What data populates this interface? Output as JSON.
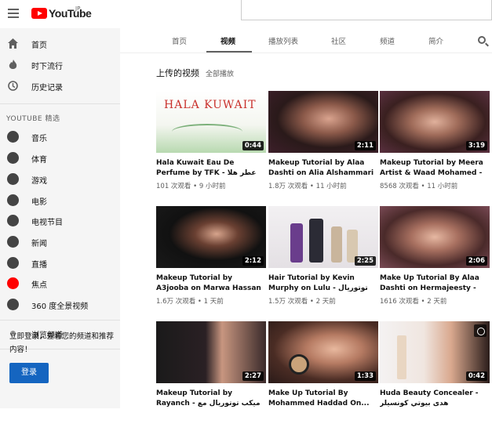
{
  "brand": {
    "logo_text": "YouTube",
    "region": "JP",
    "accent": "#ff0000"
  },
  "sidebar": {
    "main": [
      {
        "label": "首页",
        "icon": "home-icon"
      },
      {
        "label": "时下流行",
        "icon": "flame-icon"
      },
      {
        "label": "历史记录",
        "icon": "history-icon"
      }
    ],
    "section_header": "YOUTUBE 精选",
    "featured": [
      {
        "label": "音乐",
        "icon": "music-icon"
      },
      {
        "label": "体育",
        "icon": "sports-icon"
      },
      {
        "label": "游戏",
        "icon": "gaming-icon"
      },
      {
        "label": "电影",
        "icon": "movies-icon"
      },
      {
        "label": "电视节目",
        "icon": "tv-icon"
      },
      {
        "label": "新闻",
        "icon": "news-icon"
      },
      {
        "label": "直播",
        "icon": "live-icon"
      },
      {
        "label": "焦点",
        "icon": "spotlight-icon"
      },
      {
        "label": "360 度全景视频",
        "icon": "vr-icon"
      }
    ],
    "browse": {
      "label": "浏览频道",
      "icon": "add-channel-icon"
    },
    "signin_text": "立即登录，查看您的频道和推荐内容！",
    "signin_button": "登录"
  },
  "tabs": [
    "首页",
    "视频",
    "播放列表",
    "社区",
    "频道",
    "简介"
  ],
  "active_tab": 1,
  "section": {
    "title": "上传的视频",
    "play_all": "全部播放"
  },
  "videos": [
    {
      "title": "Hala Kuwait Eau De Perfume by TFK - عطر هلا كويت من تي اف",
      "views": "101 次观看",
      "time": "9 小时前",
      "duration": "0:44"
    },
    {
      "title": "Makeup Tutorial by Alaa Dashti on Alia Alshammari - ...",
      "views": "1.8万 次观看",
      "time": "11 小时前",
      "duration": "2:11"
    },
    {
      "title": "Makeup Tutorial by Meera Artist & Waad Mohamed - ...",
      "views": "8568 次观看",
      "time": "11 小时前",
      "duration": "3:19"
    },
    {
      "title": "Makeup Tutorial by A3jooba on Marwa Hassan - ميكب ...",
      "views": "1.6万 次观看",
      "time": "1 天前",
      "duration": "2:12"
    },
    {
      "title": "Hair Tutorial by Kevin Murphy on Lulu - توتوريال شعر مع كيفن ...",
      "views": "1.5万 次观看",
      "time": "2 天前",
      "duration": "2:25"
    },
    {
      "title": "Make Up Tutorial By Alaa Dashti on Hermajeesty - ميكب",
      "views": "1616 次观看",
      "time": "2 天前",
      "duration": "2:06"
    },
    {
      "title": "Makeup Tutorial by Rayanch - ميكب توتوريال مع ريان",
      "views": "",
      "time": "",
      "duration": "2:27"
    },
    {
      "title": "Make Up Tutorial By Mohammed Haddad On...",
      "views": "",
      "time": "",
      "duration": "1:33"
    },
    {
      "title": "Huda Beauty Concealer - هدى بيوتي كونسيلر",
      "views": "",
      "time": "",
      "duration": "0:42"
    }
  ],
  "thumb1_text": "HALA KUWAIT"
}
